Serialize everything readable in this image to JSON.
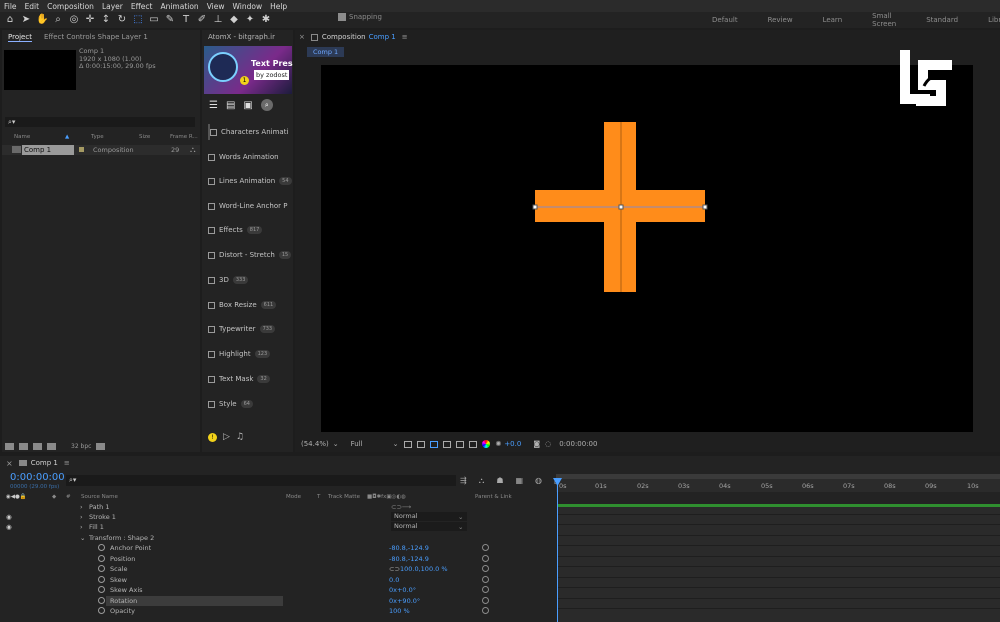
{
  "menu": [
    "File",
    "Edit",
    "Composition",
    "Layer",
    "Effect",
    "Animation",
    "View",
    "Window",
    "Help"
  ],
  "toolbar": {
    "tools": [
      "home-icon",
      "selection-icon",
      "hand-icon",
      "zoom-icon",
      "orbit-icon",
      "pan-icon",
      "dolly-icon",
      "rotate-icon",
      "region-icon",
      "rectangle-icon",
      "pen-icon",
      "text-icon",
      "brush-icon",
      "stamp-icon",
      "eraser-icon",
      "roto-icon",
      "puppet-icon"
    ],
    "snapping": "Snapping"
  },
  "workspaces": [
    "Default",
    "Review",
    "Learn",
    "Small Screen",
    "Standard",
    "Libra"
  ],
  "project": {
    "tab_project": "Project",
    "tab_effects": "Effect Controls Shape Layer 1",
    "comp_name": "Comp 1",
    "resolution": "1920 x 1080 (1.00)",
    "duration": "Δ 0:00:15:00, 29.00 fps",
    "search": "⌕▾",
    "col_name": "Name",
    "col_type": "Type",
    "col_size": "Size",
    "col_fr": "Frame R...",
    "row_name": "Comp 1",
    "row_type": "Composition",
    "row_fr": "29",
    "bpc": "32 bpc"
  },
  "atomx": {
    "tab": "AtomX - bitgraph.ir",
    "banner_title": "Text Pres",
    "banner_by": "by zodost",
    "items": [
      {
        "label": "Characters Animati",
        "count": ""
      },
      {
        "label": "Words Animation",
        "count": ""
      },
      {
        "label": "Lines Animation",
        "count": "54"
      },
      {
        "label": "Word-Line Anchor P",
        "count": ""
      },
      {
        "label": "Effects",
        "count": "817"
      },
      {
        "label": "Distort - Stretch",
        "count": "15"
      },
      {
        "label": "3D",
        "count": "333"
      },
      {
        "label": "Box Resize",
        "count": "611"
      },
      {
        "label": "Typewriter",
        "count": "733"
      },
      {
        "label": "Highlight",
        "count": "123"
      },
      {
        "label": "Text Mask",
        "count": "32"
      },
      {
        "label": "Style",
        "count": "64"
      }
    ]
  },
  "composition": {
    "tab_prefix": "Composition",
    "tab_name": "Comp 1",
    "sub_tab": "Comp 1",
    "zoom": "(54.4%)",
    "resolution": "Full",
    "exposure": "+0.0",
    "timecode": "0:00:00:00",
    "accent": "#ff8c1a"
  },
  "timeline": {
    "tab": "Comp 1",
    "time": "0:00:00:00",
    "fps": "00000 (29.00 fps)",
    "search": "⌕▾",
    "col_source": "Source Name",
    "col_mode": "Mode",
    "col_t": "T",
    "col_matte": "Track Matte",
    "col_parent": "Parent & Link",
    "props": [
      {
        "name": "Path 1",
        "indent": 89,
        "val": ""
      },
      {
        "name": "Stroke 1",
        "indent": 89,
        "val": "",
        "dd": "Normal"
      },
      {
        "name": "Fill 1",
        "indent": 89,
        "val": "",
        "dd": "Normal"
      },
      {
        "name": "Transform : Shape 2",
        "indent": 89,
        "val": ""
      },
      {
        "name": "Anchor Point",
        "indent": 110,
        "val": "-80.8,-124.9"
      },
      {
        "name": "Position",
        "indent": 110,
        "val": "-80.8,-124.9"
      },
      {
        "name": "Scale",
        "indent": 110,
        "val": "100.0,100.0 %"
      },
      {
        "name": "Skew",
        "indent": 110,
        "val": "0.0"
      },
      {
        "name": "Skew Axis",
        "indent": 110,
        "val": "0x+0.0°"
      },
      {
        "name": "Rotation",
        "indent": 110,
        "val": "0x+90.0°"
      },
      {
        "name": "Opacity",
        "indent": 110,
        "val": "100 %"
      }
    ],
    "ruler": [
      "0s",
      "01s",
      "02s",
      "03s",
      "04s",
      "05s",
      "06s",
      "07s",
      "08s",
      "09s",
      "10s"
    ]
  }
}
